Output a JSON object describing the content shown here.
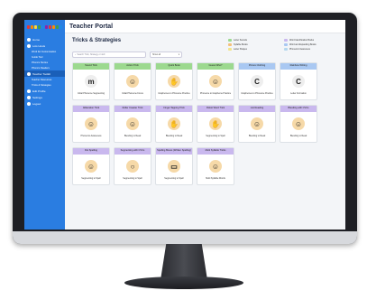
{
  "app": {
    "title": "Teacher Portal"
  },
  "logo_colors": [
    "#e53935",
    "#fb8c00",
    "#fdd835",
    "#43a047",
    "#1e88e5",
    "#8e24aa",
    "#e53935",
    "#fb8c00",
    "#43a047",
    "#1e88e5"
  ],
  "sidebar": {
    "items": [
      {
        "label": "Home",
        "type": "main"
      },
      {
        "label": "Lots Hosts",
        "type": "main"
      },
      {
        "label": "Word list Customisation",
        "type": "sub"
      },
      {
        "label": "Guide Tool",
        "type": "sub"
      },
      {
        "label": "Phonics Stories",
        "type": "sub"
      },
      {
        "label": "Phonics Readers",
        "type": "sub"
      },
      {
        "label": "Teacher Toolkit",
        "type": "main",
        "active": true
      },
      {
        "label": "Teacher Resources",
        "type": "sub"
      },
      {
        "label": "Tricks & Strategies",
        "type": "sub"
      },
      {
        "label": "Edit Profile",
        "type": "main"
      },
      {
        "label": "Settings",
        "type": "main"
      },
      {
        "label": "Logout",
        "type": "main"
      }
    ]
  },
  "page": {
    "title": "Tricks & Strategies"
  },
  "legend": [
    {
      "label": "Letter Sounds",
      "color": "#9cd98f"
    },
    {
      "label": "Word Identification Books",
      "color": "#c9b8ee"
    },
    {
      "label": "Syllable Books",
      "color": "#f4c07a"
    },
    {
      "label": "Word and Expanding Books",
      "color": "#a9c8f2"
    },
    {
      "label": "Letter Shapes",
      "color": "#f2e48a"
    },
    {
      "label": "Phonemic Awareness",
      "color": "#b6d8ee"
    }
  ],
  "search": {
    "placeholder": "Search Trick, Strategy or skill",
    "filter": "Show all"
  },
  "cards": [
    {
      "header": "Sound Trick",
      "footer": "Initial Phoneme Segmenting",
      "color": "#9cd98f",
      "glyph": "m"
    },
    {
      "header": "Action Trick",
      "footer": "Initial Phoneme Focus",
      "color": "#9cd98f",
      "glyph": "☺"
    },
    {
      "header": "Quick Book",
      "footer": "Graphemes to Phoneme Practice",
      "color": "#9cd98f",
      "glyph": "✋"
    },
    {
      "header": "Guess Who?",
      "footer": "Phoneme to Grapheme Practice",
      "color": "#9cd98f",
      "glyph": "☺"
    },
    {
      "header": "Picture Clothing",
      "footer": "Graphemes to Phoneme Practice",
      "color": "#a9c8f2",
      "glyph": "C"
    },
    {
      "header": "Rainbow Writing",
      "footer": "Letter Formation",
      "color": "#a9c8f2",
      "glyph": "C"
    },
    {
      "header": "Alliteration Trick",
      "footer": "Phonemic Awareness",
      "color": "#c9b8ee",
      "glyph": "☺"
    },
    {
      "header": "Roller Coaster Trick",
      "footer": "Blending to Read",
      "color": "#c9b8ee",
      "glyph": "☺"
    },
    {
      "header": "Finger Tapping Trick",
      "footer": "Blending to Read",
      "color": "#c9b8ee",
      "glyph": "✋"
    },
    {
      "header": "Robot Word Trick",
      "footer": "Segmenting to Spell",
      "color": "#c9b8ee",
      "glyph": "✋"
    },
    {
      "header": "List Reading",
      "footer": "Blending to Read",
      "color": "#c9b8ee",
      "glyph": "☺"
    },
    {
      "header": "Blending with CVCs",
      "footer": "Blending to Read",
      "color": "#c9b8ee",
      "glyph": "☺"
    },
    {
      "header": "Dot Spelling",
      "footer": "Segmenting to Spell",
      "color": "#c9b8ee",
      "glyph": "☺"
    },
    {
      "header": "Segmenting with CVCs",
      "footer": "Segmenting to Spell",
      "color": "#c9b8ee",
      "glyph": "○"
    },
    {
      "header": "Spelling Boxes (Written Spelling)",
      "footer": "Segmenting to Spell",
      "color": "#c9b8ee",
      "glyph": "▭"
    },
    {
      "header": "Multi Syllable Tricks",
      "footer": "Multi Syllable Words",
      "color": "#c9b8ee",
      "glyph": "☺"
    }
  ]
}
